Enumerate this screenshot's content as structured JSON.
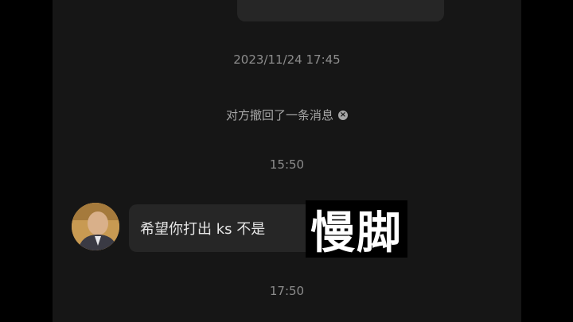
{
  "chat": {
    "timestamp_1": "2023/11/24 17:45",
    "recall_notice": "对方撤回了一条消息",
    "timestamp_2": "15:50",
    "message_text": "希望你打出 ks 不是",
    "timestamp_3": "17:50"
  },
  "overlay": {
    "caption": "慢脚"
  },
  "colors": {
    "screen_bg": "#161616",
    "bubble_bg": "#262626",
    "meta_text": "#8c8c8c"
  }
}
